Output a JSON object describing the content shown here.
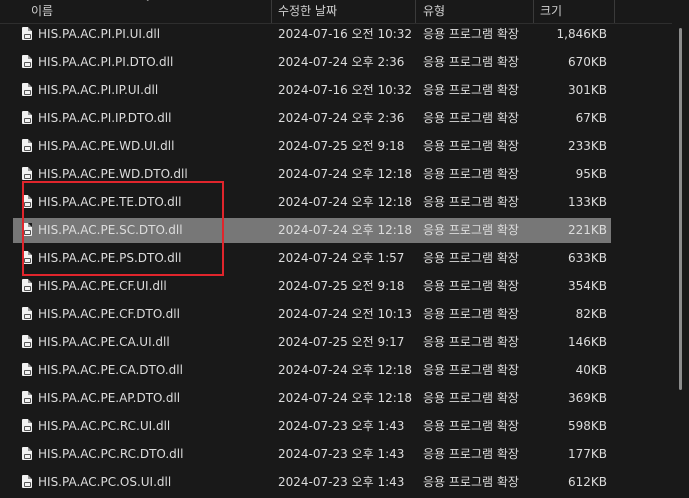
{
  "columns": {
    "name": "이름",
    "date": "수정한 날짜",
    "type": "유형",
    "size": "크기"
  },
  "files": [
    {
      "name": "HIS.PA.AC.PI.PI.UI.dll",
      "date": "2024-07-16 오전 10:32",
      "type": "응용 프로그램 확장",
      "size": "1,846KB"
    },
    {
      "name": "HIS.PA.AC.PI.PI.DTO.dll",
      "date": "2024-07-24 오후 2:36",
      "type": "응용 프로그램 확장",
      "size": "670KB"
    },
    {
      "name": "HIS.PA.AC.PI.IP.UI.dll",
      "date": "2024-07-16 오전 10:32",
      "type": "응용 프로그램 확장",
      "size": "301KB"
    },
    {
      "name": "HIS.PA.AC.PI.IP.DTO.dll",
      "date": "2024-07-24 오후 2:36",
      "type": "응용 프로그램 확장",
      "size": "67KB"
    },
    {
      "name": "HIS.PA.AC.PE.WD.UI.dll",
      "date": "2024-07-25 오전 9:18",
      "type": "응용 프로그램 확장",
      "size": "233KB"
    },
    {
      "name": "HIS.PA.AC.PE.WD.DTO.dll",
      "date": "2024-07-24 오후 12:18",
      "type": "응용 프로그램 확장",
      "size": "95KB"
    },
    {
      "name": "HIS.PA.AC.PE.TE.DTO.dll",
      "date": "2024-07-24 오후 12:18",
      "type": "응용 프로그램 확장",
      "size": "133KB"
    },
    {
      "name": "HIS.PA.AC.PE.SC.DTO.dll",
      "date": "2024-07-24 오후 12:18",
      "type": "응용 프로그램 확장",
      "size": "221KB",
      "selected": true
    },
    {
      "name": "HIS.PA.AC.PE.PS.DTO.dll",
      "date": "2024-07-24 오후 1:57",
      "type": "응용 프로그램 확장",
      "size": "633KB"
    },
    {
      "name": "HIS.PA.AC.PE.CF.UI.dll",
      "date": "2024-07-25 오전 9:18",
      "type": "응용 프로그램 확장",
      "size": "354KB"
    },
    {
      "name": "HIS.PA.AC.PE.CF.DTO.dll",
      "date": "2024-07-24 오전 10:13",
      "type": "응용 프로그램 확장",
      "size": "82KB"
    },
    {
      "name": "HIS.PA.AC.PE.CA.UI.dll",
      "date": "2024-07-25 오전 9:17",
      "type": "응용 프로그램 확장",
      "size": "146KB"
    },
    {
      "name": "HIS.PA.AC.PE.CA.DTO.dll",
      "date": "2024-07-24 오후 12:18",
      "type": "응용 프로그램 확장",
      "size": "40KB"
    },
    {
      "name": "HIS.PA.AC.PE.AP.DTO.dll",
      "date": "2024-07-24 오후 12:18",
      "type": "응용 프로그램 확장",
      "size": "369KB"
    },
    {
      "name": "HIS.PA.AC.PC.RC.UI.dll",
      "date": "2024-07-23 오후 1:43",
      "type": "응용 프로그램 확장",
      "size": "598KB"
    },
    {
      "name": "HIS.PA.AC.PC.RC.DTO.dll",
      "date": "2024-07-23 오후 1:43",
      "type": "응용 프로그램 확장",
      "size": "177KB"
    },
    {
      "name": "HIS.PA.AC.PC.OS.UI.dll",
      "date": "2024-07-23 오후 1:43",
      "type": "응용 프로그램 확장",
      "size": "612KB"
    }
  ],
  "icons": {
    "file": "dll-file-icon",
    "sort": "sort-indicator-icon"
  },
  "colors": {
    "background": "#191919",
    "selection": "#777777",
    "highlight_box": "#e0252c"
  }
}
